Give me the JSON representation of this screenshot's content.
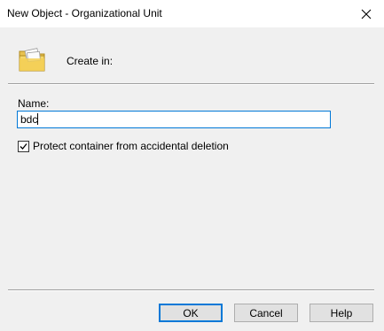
{
  "window": {
    "title": "New Object - Organizational Unit",
    "close_icon": "close-icon"
  },
  "header": {
    "icon": "organizational-unit-folder-icon",
    "create_in_label": "Create in:"
  },
  "form": {
    "name_label": "Name:",
    "name_value": "bdc",
    "protect_label": "Protect container from accidental deletion",
    "protect_checked": true
  },
  "buttons": {
    "ok": "OK",
    "cancel": "Cancel",
    "help": "Help"
  },
  "colors": {
    "accent": "#0078d7",
    "dialog_bg": "#f0f0f0"
  }
}
